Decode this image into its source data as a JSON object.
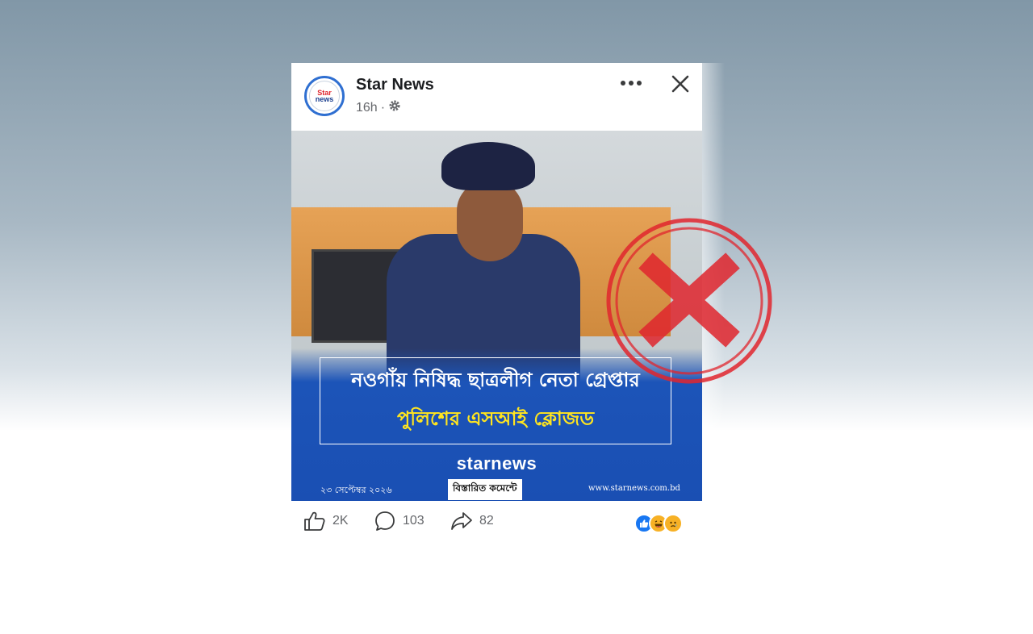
{
  "post": {
    "page_name": "Star News",
    "time": "16h",
    "separator": "·",
    "avatar_text_top": "Star",
    "avatar_text_bottom": "news"
  },
  "image": {
    "headline_line1": "নওগাঁয় নিষিদ্ধ ছাত্রলীগ নেতা গ্রেপ্তার",
    "headline_line2": "পুলিশের এসআই ক্লোজড",
    "brand": "starnews",
    "date": "২৩ সেপ্টেম্বর ২০২৬",
    "cta": "বিস্তারিত কমেন্টে",
    "url": "www.starnews.com.bd"
  },
  "actions": {
    "likes": "2K",
    "comments": "103",
    "shares": "82"
  },
  "icons": {
    "more": "more-horizontal-icon",
    "close": "close-icon",
    "privacy": "gear-icon",
    "like": "thumbs-up-icon",
    "comment": "comment-icon",
    "share": "share-icon",
    "reaction_like": "like-reaction-icon",
    "reaction_haha": "haha-reaction-icon",
    "reaction_sad": "sad-reaction-icon",
    "stamp": "red-x-stamp"
  },
  "colors": {
    "page_name": "#1c1e21",
    "meta": "#65676b",
    "banner_blue": "#1a4fb3",
    "headline_yellow": "#ffe51f",
    "stamp_red": "#e0262e",
    "facebook_blue": "#1877f2"
  }
}
